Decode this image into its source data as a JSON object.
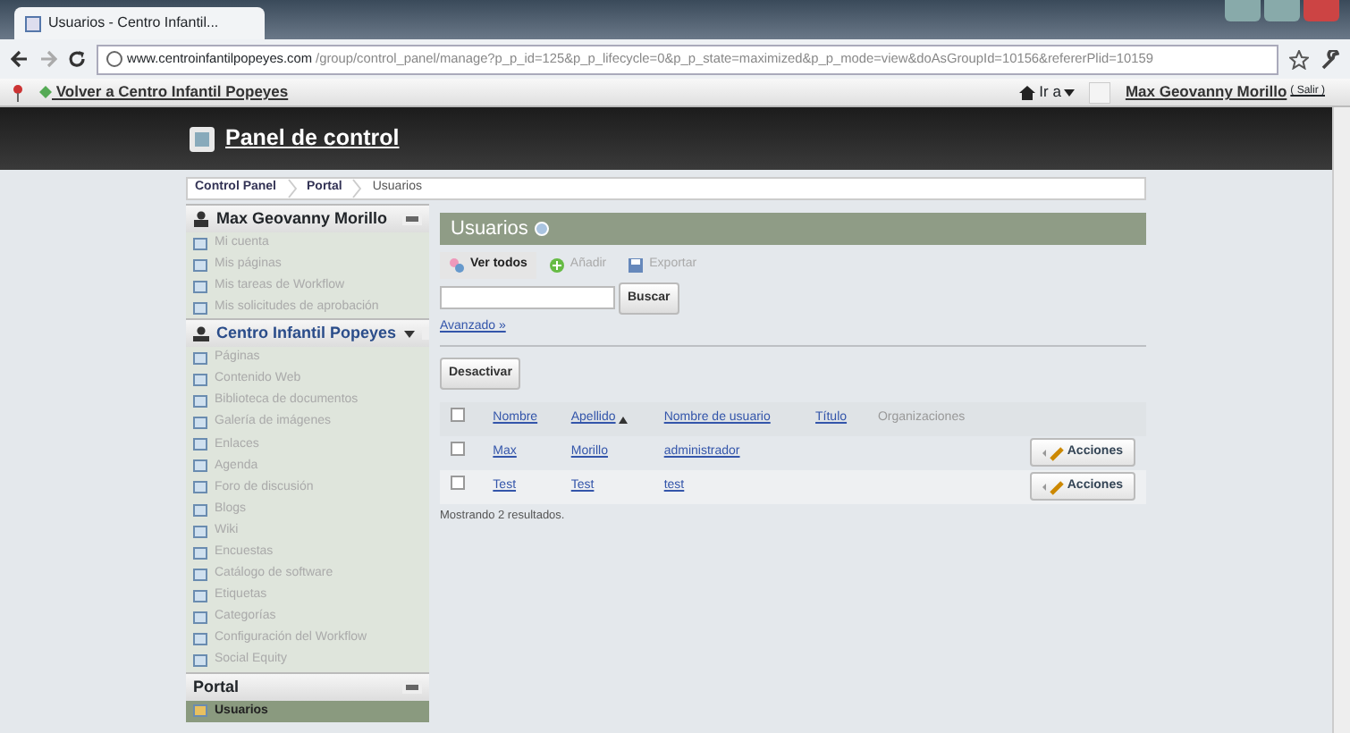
{
  "browser": {
    "tab_title": "Usuarios - Centro Infantil...",
    "url_host": "www.centroinfantilpopeyes.com",
    "url_path": "/group/control_panel/manage?p_p_id=125&p_p_lifecycle=0&p_p_state=maximized&p_p_mode=view&doAsGroupId=10156&refererPlid=10159"
  },
  "dockbar": {
    "back_link": "Volver a Centro Infantil Popeyes",
    "goto": "Ir a",
    "user": "Max Geovanny Morillo",
    "signout": "( Salir )"
  },
  "header": {
    "title": "Panel de control"
  },
  "breadcrumb": [
    "Control Panel",
    "Portal",
    "Usuarios"
  ],
  "sidebar": [
    {
      "title": "Max Geovanny Morillo",
      "kind": "user",
      "dropdown": false,
      "items": [
        {
          "label": "Mi cuenta",
          "selected": false
        },
        {
          "label": "Mis páginas",
          "selected": false
        },
        {
          "label": "Mis tareas de Workflow",
          "selected": false
        },
        {
          "label": "Mis solicitudes de aprobación",
          "selected": false
        }
      ]
    },
    {
      "title": "Centro Infantil Popeyes",
      "kind": "site",
      "dropdown": true,
      "items": [
        {
          "label": "Páginas",
          "selected": false
        },
        {
          "label": "Contenido Web",
          "selected": false
        },
        {
          "label": "Biblioteca de documentos",
          "selected": false
        },
        {
          "label": "Galería de imágenes",
          "selected": false
        },
        {
          "label": "Enlaces",
          "selected": false
        },
        {
          "label": "Agenda",
          "selected": false
        },
        {
          "label": "Foro de discusión",
          "selected": false
        },
        {
          "label": "Blogs",
          "selected": false
        },
        {
          "label": "Wiki",
          "selected": false
        },
        {
          "label": "Encuestas",
          "selected": false
        },
        {
          "label": "Catálogo de software",
          "selected": false
        },
        {
          "label": "Etiquetas",
          "selected": false
        },
        {
          "label": "Categorías",
          "selected": false
        },
        {
          "label": "Configuración del Workflow",
          "selected": false
        },
        {
          "label": "Social Equity",
          "selected": false
        }
      ]
    },
    {
      "title": "Portal",
      "kind": "plain",
      "dropdown": false,
      "items": [
        {
          "label": "Usuarios",
          "selected": true
        }
      ]
    }
  ],
  "main": {
    "title": "Usuarios",
    "tabs": [
      {
        "label": "Ver todos",
        "selected": true
      },
      {
        "label": "Añadir",
        "selected": false
      },
      {
        "label": "Exportar",
        "selected": false
      }
    ],
    "search_button": "Buscar",
    "advanced_link": "Avanzado »",
    "deactivate_button": "Desactivar",
    "columns": [
      {
        "label": "Nombre",
        "link": true,
        "sorted": false
      },
      {
        "label": "Apellido",
        "link": true,
        "sorted": true
      },
      {
        "label": "Nombre de usuario",
        "link": true,
        "sorted": false
      },
      {
        "label": "Título",
        "link": true,
        "sorted": false
      },
      {
        "label": "Organizaciones",
        "link": false,
        "sorted": false
      }
    ],
    "rows": [
      {
        "cells": [
          "Max",
          "Morillo",
          "administrador"
        ],
        "checked": false,
        "action": "Acciones"
      },
      {
        "cells": [
          "Test",
          "Test",
          "test"
        ],
        "checked": false,
        "action": "Acciones"
      }
    ],
    "select_all_checked": false,
    "result_text": "Mostrando 2 resultados."
  }
}
